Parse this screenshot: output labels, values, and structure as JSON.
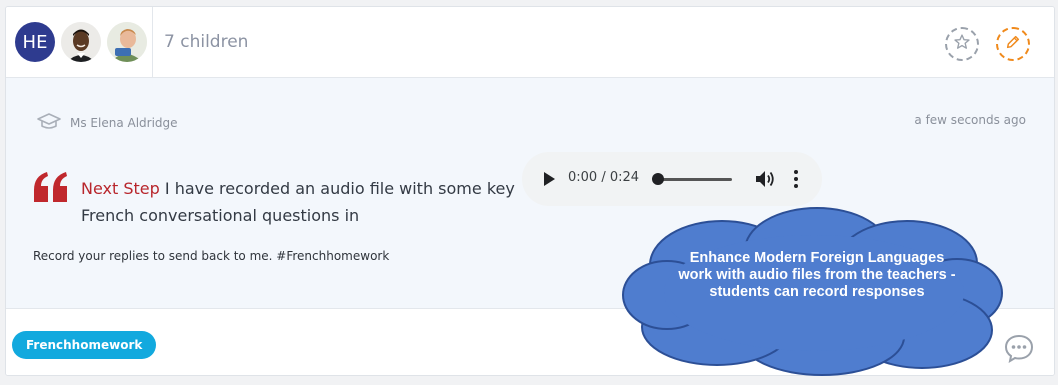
{
  "header": {
    "avatar_initials": "HE",
    "children_label": "7 children",
    "favorite_icon": "star-icon",
    "edit_icon": "pencil-icon"
  },
  "post": {
    "author": "Ms Elena Aldridge",
    "author_icon": "graduation-cap-icon",
    "timestamp": "a few seconds ago",
    "note_prefix": "Next Step",
    "note_body": "I have recorded an audio file with some key French conversational questions in",
    "caption": "Record your replies to send back to me. #Frenchhomework",
    "audio": {
      "time": "0:00 / 0:24",
      "progress": 0
    }
  },
  "footer": {
    "tag_label": "Frenchhomework",
    "comment_icon": "speech-bubble-icon"
  },
  "callout": {
    "text": "Enhance Modern Foreign Languages work with audio files from the teachers - students can record responses",
    "color": "#4f7dcf"
  },
  "colors": {
    "accent_red": "#b8262c",
    "tag_blue": "#12a9de",
    "edit_orange": "#f08a1c",
    "avatar_navy": "#2e3b8f"
  }
}
